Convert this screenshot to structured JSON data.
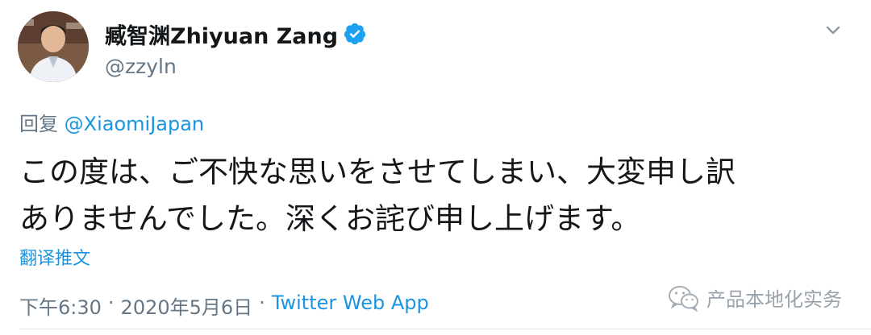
{
  "author": {
    "display_name": "臧智渊Zhiyuan Zang",
    "handle": "@zzyln",
    "verified": true
  },
  "reply": {
    "prefix": "回复",
    "mention": "@XiaomiJapan"
  },
  "tweet": {
    "lines": [
      "この度は、ご不快な思いをさせてしまい、大変申し訳",
      "ありませんでした。深くお詫び申し上げます。"
    ]
  },
  "translate_label": "翻译推文",
  "meta": {
    "time": "下午6:30",
    "separator": "·",
    "date": "2020年5月6日",
    "app": "Twitter Web App"
  },
  "watermark": {
    "text": "产品本地化实务",
    "icon": "wechat-icon"
  },
  "colors": {
    "link": "#1b95e0",
    "secondary": "#657786",
    "text": "#14171a"
  }
}
